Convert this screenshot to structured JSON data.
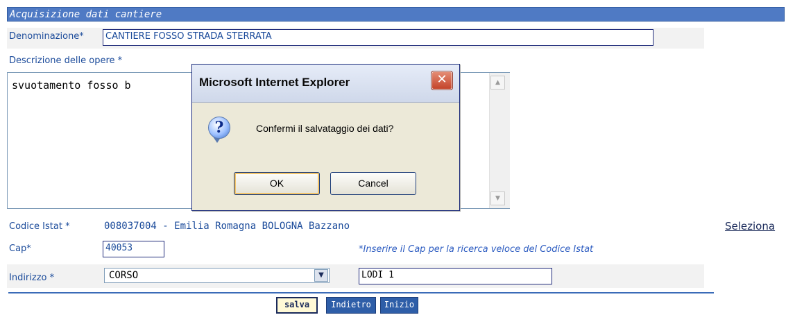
{
  "form": {
    "section_title": "Acquisizione dati cantiere",
    "denominazione": {
      "label": "Denominazione*",
      "value": "CANTIERE FOSSO STRADA STERRATA"
    },
    "descrizione": {
      "label": "Descrizione delle opere *",
      "value": "svuotamento fosso b"
    },
    "codice_istat": {
      "label": "Codice Istat *",
      "value": "008037004 - Emilia Romagna BOLOGNA Bazzano",
      "link": "Seleziona"
    },
    "cap": {
      "label": "Cap*",
      "value": "40053",
      "hint": "*Inserire il Cap per la ricerca veloce del Codice Istat"
    },
    "indirizzo": {
      "label": "Indirizzo *",
      "type_value": "CORSO",
      "street_value": "LODI 1"
    }
  },
  "buttons": {
    "salva": "salva",
    "indietro": "Indietro",
    "inizio": "Inizio"
  },
  "dialog": {
    "title": "Microsoft Internet Explorer",
    "message": "Confermi il salvataggio dei dati?",
    "ok": "OK",
    "cancel": "Cancel",
    "icon": "question-icon"
  },
  "colors": {
    "header_bg": "#4f7ac4",
    "label_text": "#1a4a9a",
    "button_blue": "#2e5ea8",
    "salva_bg": "#fff9d6",
    "dialog_bg": "#ece9d8",
    "close_red": "#c4442a"
  }
}
